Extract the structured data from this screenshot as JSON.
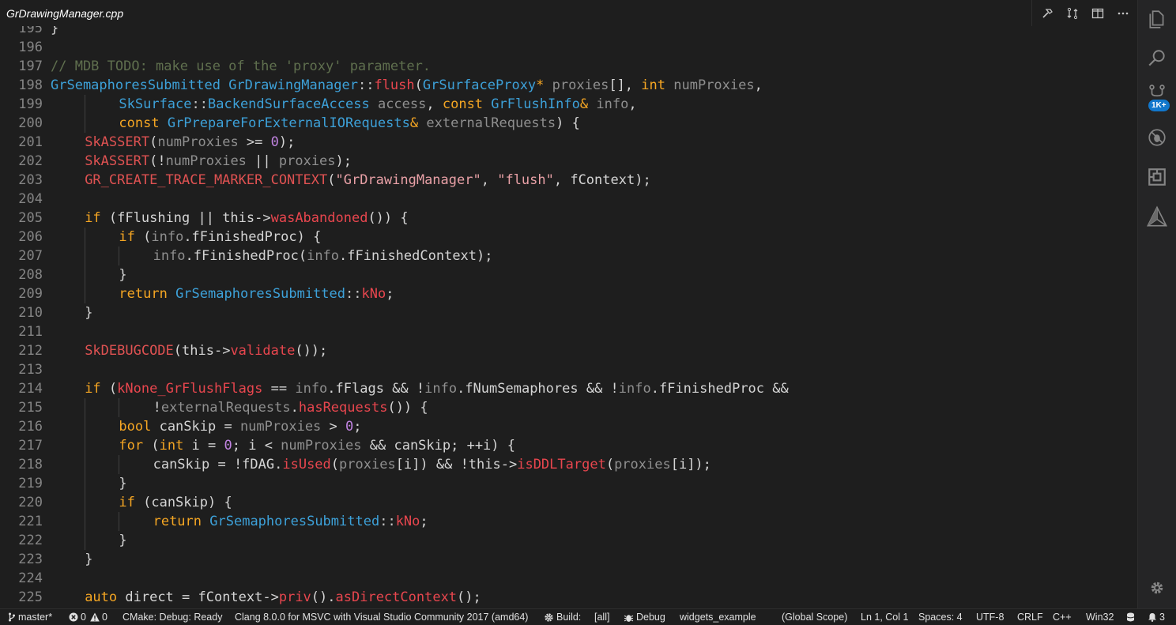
{
  "tab": {
    "title": "GrDrawingManager.cpp"
  },
  "tab_actions": [
    "hammer-icon",
    "compare-changes-icon",
    "split-editor-icon",
    "more-actions-icon"
  ],
  "activity_bar": {
    "items": [
      "explorer-icon",
      "search-icon",
      "source-control-icon",
      "debug-icon",
      "extensions-icon",
      "cmake-icon"
    ],
    "badge": "1K+",
    "bottom": "settings-gear-icon"
  },
  "colors": {
    "keyword": "#f5a623",
    "type": "#3da1d9",
    "function": "#e8464e",
    "comment": "#5f6f4e",
    "string": "#e8a0a6",
    "number": "#c083e0",
    "background": "#1e1e1e"
  },
  "code": {
    "lines": [
      {
        "n": "195",
        "i": 0,
        "t": [
          [
            "}",
            ""
          ]
        ]
      },
      {
        "n": "196",
        "i": 0,
        "t": []
      },
      {
        "n": "197",
        "i": 0,
        "t": [
          [
            "// MDB TODO: make use of the 'proxy' parameter.",
            "cm"
          ]
        ]
      },
      {
        "n": "198",
        "i": 0,
        "t": [
          [
            "GrSemaphoresSubmitted",
            "ty"
          ],
          [
            " ",
            ""
          ],
          [
            "GrDrawingManager",
            "ty"
          ],
          [
            "::",
            "op"
          ],
          [
            "flush",
            "fn"
          ],
          [
            "(",
            ""
          ],
          [
            "GrSurfaceProxy",
            "ty"
          ],
          [
            "*",
            "kw"
          ],
          [
            " ",
            ""
          ],
          [
            "proxies",
            "pr"
          ],
          [
            "[], ",
            ""
          ],
          [
            "int",
            "kw"
          ],
          [
            " ",
            ""
          ],
          [
            "numProxies",
            "pr"
          ],
          [
            ",",
            ""
          ]
        ]
      },
      {
        "n": "199",
        "i": 2,
        "t": [
          [
            "SkSurface",
            "ty"
          ],
          [
            "::",
            "op"
          ],
          [
            "BackendSurfaceAccess",
            "ty"
          ],
          [
            " ",
            ""
          ],
          [
            "access",
            "pr"
          ],
          [
            ", ",
            ""
          ],
          [
            "const",
            "kw"
          ],
          [
            " ",
            ""
          ],
          [
            "GrFlushInfo",
            "ty"
          ],
          [
            "&",
            "kw"
          ],
          [
            " ",
            ""
          ],
          [
            "info",
            "pr"
          ],
          [
            ",",
            ""
          ]
        ]
      },
      {
        "n": "200",
        "i": 2,
        "t": [
          [
            "const",
            "kw"
          ],
          [
            " ",
            ""
          ],
          [
            "GrPrepareForExternalIORequests",
            "ty"
          ],
          [
            "&",
            "kw"
          ],
          [
            " ",
            ""
          ],
          [
            "externalRequests",
            "pr"
          ],
          [
            ") {",
            ""
          ]
        ]
      },
      {
        "n": "201",
        "i": 1,
        "t": [
          [
            "SkASSERT",
            "mc"
          ],
          [
            "(",
            ""
          ],
          [
            "numProxies",
            "pr"
          ],
          [
            " >= ",
            ""
          ],
          [
            "0",
            "nu"
          ],
          [
            ");",
            ""
          ]
        ]
      },
      {
        "n": "202",
        "i": 1,
        "t": [
          [
            "SkASSERT",
            "mc"
          ],
          [
            "(!",
            ""
          ],
          [
            "numProxies",
            "pr"
          ],
          [
            " || ",
            ""
          ],
          [
            "proxies",
            "pr"
          ],
          [
            ");",
            ""
          ]
        ]
      },
      {
        "n": "203",
        "i": 1,
        "t": [
          [
            "GR_CREATE_TRACE_MARKER_CONTEXT",
            "mc"
          ],
          [
            "(",
            ""
          ],
          [
            "\"GrDrawingManager\"",
            "st"
          ],
          [
            ", ",
            ""
          ],
          [
            "\"flush\"",
            "st"
          ],
          [
            ", fContext);",
            ""
          ]
        ]
      },
      {
        "n": "204",
        "i": 0,
        "t": []
      },
      {
        "n": "205",
        "i": 1,
        "t": [
          [
            "if",
            "kw"
          ],
          [
            " (fFlushing || this->",
            ""
          ],
          [
            "wasAbandoned",
            "fn"
          ],
          [
            "()) {",
            ""
          ]
        ]
      },
      {
        "n": "206",
        "i": 2,
        "t": [
          [
            "if",
            "kw"
          ],
          [
            " (",
            ""
          ],
          [
            "info",
            "pr"
          ],
          [
            ".fFinishedProc) {",
            ""
          ]
        ]
      },
      {
        "n": "207",
        "i": 3,
        "t": [
          [
            "info",
            "pr"
          ],
          [
            ".fFinishedProc(",
            ""
          ],
          [
            "info",
            "pr"
          ],
          [
            ".fFinishedContext);",
            ""
          ]
        ]
      },
      {
        "n": "208",
        "i": 2,
        "t": [
          [
            "}",
            ""
          ]
        ]
      },
      {
        "n": "209",
        "i": 2,
        "t": [
          [
            "return",
            "kw"
          ],
          [
            " ",
            ""
          ],
          [
            "GrSemaphoresSubmitted",
            "ty"
          ],
          [
            "::",
            "op"
          ],
          [
            "kNo",
            "fn"
          ],
          [
            ";",
            ""
          ]
        ]
      },
      {
        "n": "210",
        "i": 1,
        "t": [
          [
            "}",
            ""
          ]
        ]
      },
      {
        "n": "211",
        "i": 0,
        "t": []
      },
      {
        "n": "212",
        "i": 1,
        "t": [
          [
            "SkDEBUGCODE",
            "mc"
          ],
          [
            "(this->",
            ""
          ],
          [
            "validate",
            "fn"
          ],
          [
            "());",
            ""
          ]
        ]
      },
      {
        "n": "213",
        "i": 0,
        "t": []
      },
      {
        "n": "214",
        "i": 1,
        "t": [
          [
            "if",
            "kw"
          ],
          [
            " (",
            ""
          ],
          [
            "kNone_GrFlushFlags",
            "fn"
          ],
          [
            " == ",
            ""
          ],
          [
            "info",
            "pr"
          ],
          [
            ".fFlags && !",
            ""
          ],
          [
            "info",
            "pr"
          ],
          [
            ".fNumSemaphores && !",
            ""
          ],
          [
            "info",
            "pr"
          ],
          [
            ".fFinishedProc &&",
            ""
          ]
        ]
      },
      {
        "n": "215",
        "i": 3,
        "t": [
          [
            "!",
            ""
          ],
          [
            "externalRequests",
            "pr"
          ],
          [
            ".",
            ""
          ],
          [
            "hasRequests",
            "fn"
          ],
          [
            "()) {",
            ""
          ]
        ]
      },
      {
        "n": "216",
        "i": 2,
        "t": [
          [
            "bool",
            "kw"
          ],
          [
            " canSkip = ",
            ""
          ],
          [
            "numProxies",
            "pr"
          ],
          [
            " > ",
            ""
          ],
          [
            "0",
            "nu"
          ],
          [
            ";",
            ""
          ]
        ]
      },
      {
        "n": "217",
        "i": 2,
        "t": [
          [
            "for",
            "kw"
          ],
          [
            " (",
            ""
          ],
          [
            "int",
            "kw"
          ],
          [
            " i = ",
            ""
          ],
          [
            "0",
            "nu"
          ],
          [
            "; i < ",
            ""
          ],
          [
            "numProxies",
            "pr"
          ],
          [
            " && canSkip; ++i) {",
            ""
          ]
        ]
      },
      {
        "n": "218",
        "i": 3,
        "t": [
          [
            "canSkip = !fDAG.",
            ""
          ],
          [
            "isUsed",
            "fn"
          ],
          [
            "(",
            ""
          ],
          [
            "proxies",
            "pr"
          ],
          [
            "[i]) && !this->",
            ""
          ],
          [
            "isDDLTarget",
            "fn"
          ],
          [
            "(",
            ""
          ],
          [
            "proxies",
            "pr"
          ],
          [
            "[i]);",
            ""
          ]
        ]
      },
      {
        "n": "219",
        "i": 2,
        "t": [
          [
            "}",
            ""
          ]
        ]
      },
      {
        "n": "220",
        "i": 2,
        "t": [
          [
            "if",
            "kw"
          ],
          [
            " (canSkip) {",
            ""
          ]
        ]
      },
      {
        "n": "221",
        "i": 3,
        "t": [
          [
            "return",
            "kw"
          ],
          [
            " ",
            ""
          ],
          [
            "GrSemaphoresSubmitted",
            "ty"
          ],
          [
            "::",
            "op"
          ],
          [
            "kNo",
            "fn"
          ],
          [
            ";",
            ""
          ]
        ]
      },
      {
        "n": "222",
        "i": 2,
        "t": [
          [
            "}",
            ""
          ]
        ]
      },
      {
        "n": "223",
        "i": 1,
        "t": [
          [
            "}",
            ""
          ]
        ]
      },
      {
        "n": "224",
        "i": 0,
        "t": []
      },
      {
        "n": "225",
        "i": 1,
        "t": [
          [
            "auto",
            "kw"
          ],
          [
            " direct = fContext->",
            ""
          ],
          [
            "priv",
            "fn"
          ],
          [
            "().",
            ""
          ],
          [
            "asDirectContext",
            "fn"
          ],
          [
            "();",
            ""
          ]
        ]
      }
    ]
  },
  "status": {
    "branch": "master*",
    "errors": "0",
    "warnings": "0",
    "cmake": "CMake: Debug: Ready",
    "kit": "Clang 8.0.0 for MSVC with Visual Studio Community 2017 (amd64)",
    "build_label": "Build:",
    "build_target": "[all]",
    "debug_label": "Debug",
    "launch_target": "widgets_example",
    "scope": "(Global Scope)",
    "position": "Ln 1, Col 1",
    "spaces": "Spaces: 4",
    "encoding": "UTF-8",
    "eol": "CRLF",
    "language": "C++",
    "platform": "Win32",
    "notifications": "3"
  }
}
